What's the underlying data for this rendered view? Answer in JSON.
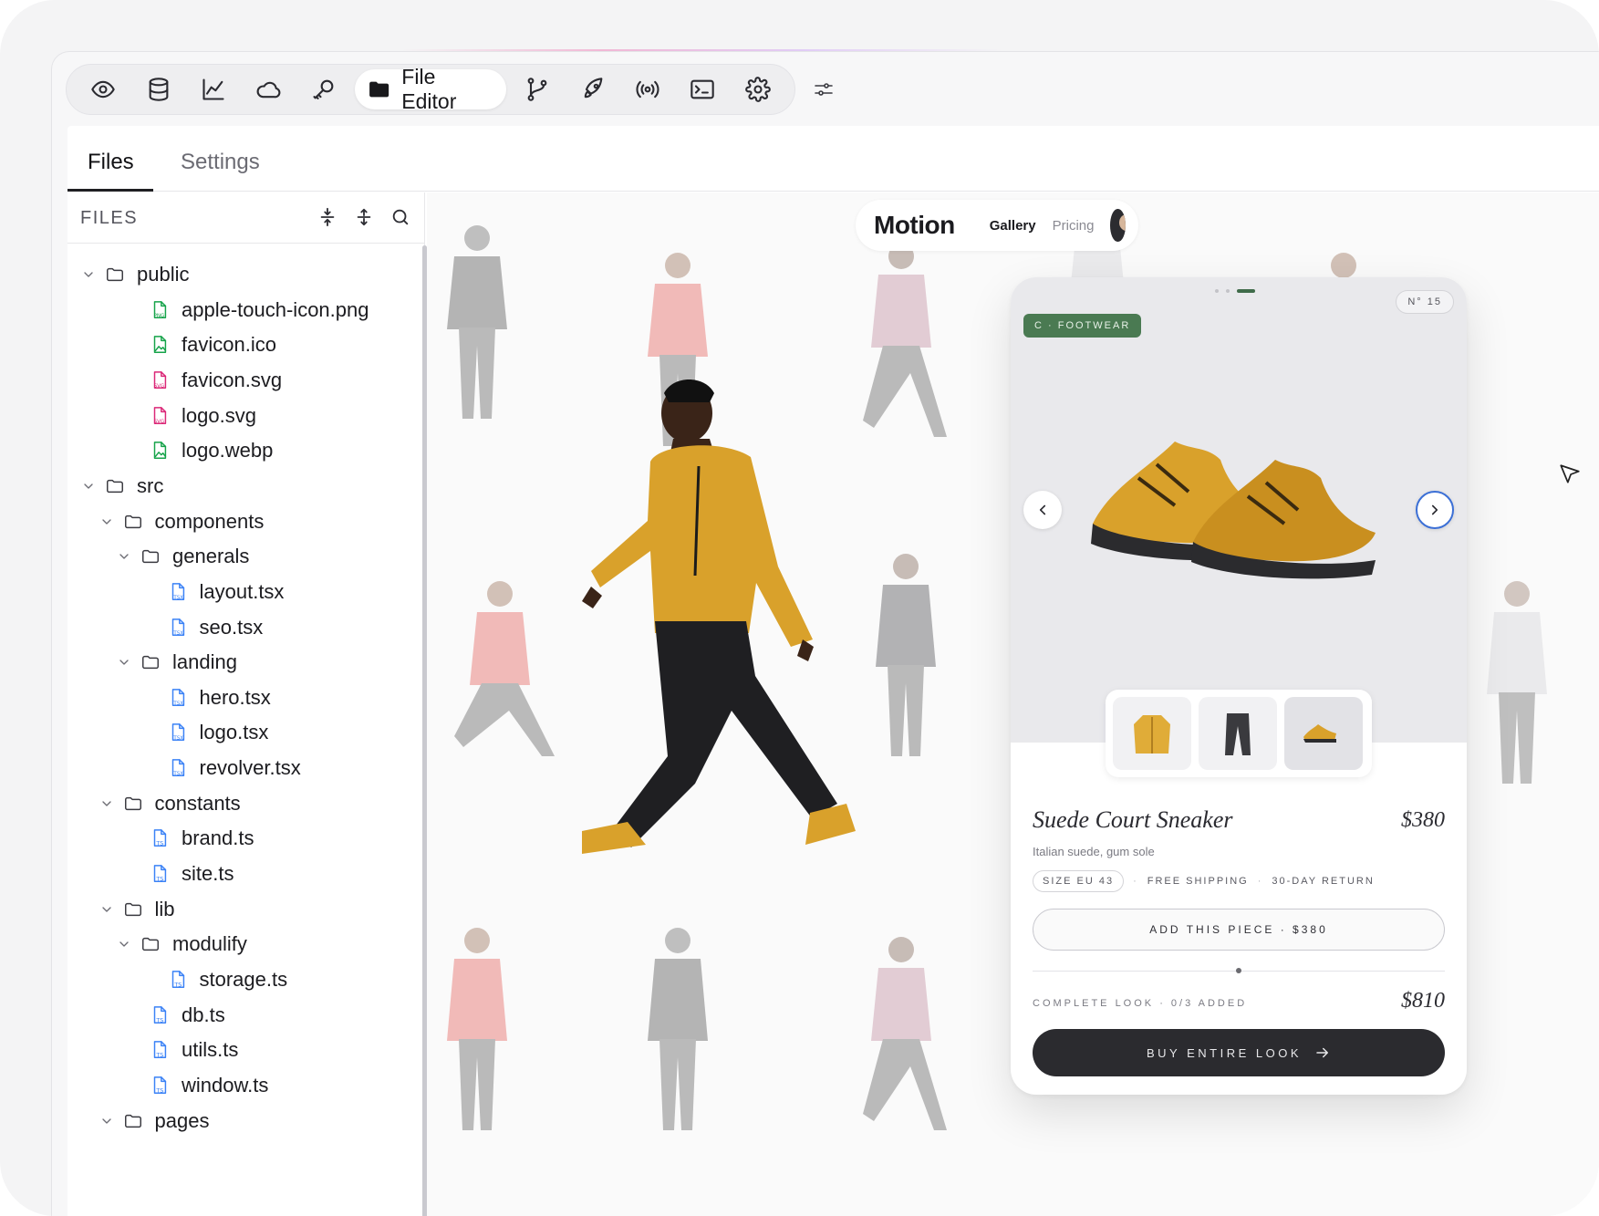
{
  "toolbar": {
    "active_label": "File Editor",
    "icons": [
      "eye-icon",
      "database-icon",
      "chart-icon",
      "cloud-icon",
      "key-icon",
      "folder-icon",
      "git-branch-icon",
      "rocket-icon",
      "broadcast-icon",
      "terminal-icon",
      "gear-icon",
      "sliders-icon"
    ]
  },
  "tabs": [
    {
      "label": "Files"
    },
    {
      "label": "Settings"
    }
  ],
  "sidebar": {
    "title": "FILES",
    "tree": [
      {
        "label": "public",
        "type": "folder"
      },
      {
        "label": "apple-touch-icon.png",
        "type": "png"
      },
      {
        "label": "favicon.ico",
        "type": "image"
      },
      {
        "label": "favicon.svg",
        "type": "svg"
      },
      {
        "label": "logo.svg",
        "type": "svg"
      },
      {
        "label": "logo.webp",
        "type": "image"
      },
      {
        "label": "src",
        "type": "folder"
      },
      {
        "label": "components",
        "type": "folder"
      },
      {
        "label": "generals",
        "type": "folder"
      },
      {
        "label": "layout.tsx",
        "type": "tsx"
      },
      {
        "label": "seo.tsx",
        "type": "tsx"
      },
      {
        "label": "landing",
        "type": "folder"
      },
      {
        "label": "hero.tsx",
        "type": "tsx"
      },
      {
        "label": "logo.tsx",
        "type": "tsx"
      },
      {
        "label": "revolver.tsx",
        "type": "tsx"
      },
      {
        "label": "constants",
        "type": "folder"
      },
      {
        "label": "brand.ts",
        "type": "ts"
      },
      {
        "label": "site.ts",
        "type": "ts"
      },
      {
        "label": "lib",
        "type": "folder"
      },
      {
        "label": "modulify",
        "type": "folder"
      },
      {
        "label": "storage.ts",
        "type": "ts"
      },
      {
        "label": "db.ts",
        "type": "ts"
      },
      {
        "label": "utils.ts",
        "type": "ts"
      },
      {
        "label": "window.ts",
        "type": "ts"
      },
      {
        "label": "pages",
        "type": "folder"
      }
    ]
  },
  "site": {
    "brand": "Motion",
    "nav": [
      {
        "label": "Gallery"
      },
      {
        "label": "Pricing"
      }
    ]
  },
  "product": {
    "category": "C · FOOTWEAR",
    "number": "N° 15",
    "name": "Suede Court Sneaker",
    "price": "$380",
    "description": "Italian suede, gum sole",
    "size": "SIZE EU 43",
    "shipping": "FREE SHIPPING",
    "returns": "30-DAY RETURN",
    "add_button": "ADD THIS PIECE · $380",
    "look_label": "COMPLETE LOOK · 0/3 ADDED",
    "look_price": "$810",
    "buy_button": "BUY ENTIRE LOOK"
  },
  "colors": {
    "jacket": "#d9a12b",
    "accent_green": "#4a7a52",
    "dark_button": "#2b2b2f",
    "next_ring": "#3b6fd6"
  }
}
